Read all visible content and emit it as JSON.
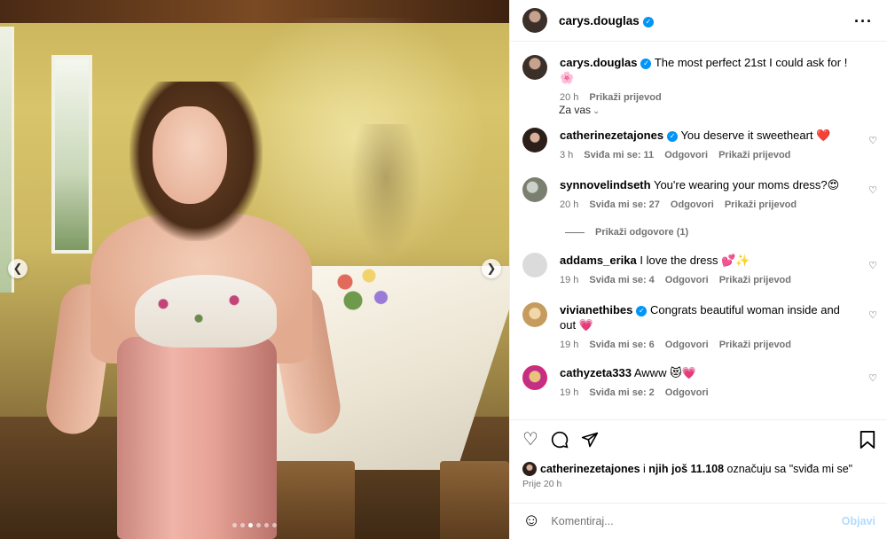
{
  "header": {
    "username": "carys.douglas",
    "more_icon": "more-horizontal-icon"
  },
  "caption": {
    "username": "carys.douglas",
    "text": "The most perfect 21st I could ask for ! 🌸",
    "time": "20 h",
    "translate": "Prikaži prijevod"
  },
  "sort_label": "Za vas",
  "comments": [
    {
      "username": "catherinezetajones",
      "verified": true,
      "text": "You deserve it sweetheart ❤️",
      "time": "3 h",
      "likes": "Sviđa mi se: 11",
      "reply": "Odgovori",
      "translate": "Prikaži prijevod"
    },
    {
      "username": "synnovelindseth",
      "verified": false,
      "text": "You're wearing your moms dress?😍",
      "time": "20 h",
      "likes": "Sviđa mi se: 27",
      "reply": "Odgovori",
      "translate": "Prikaži prijevod"
    },
    {
      "username": "addams_erika",
      "verified": false,
      "text": "I love the dress 💕✨",
      "time": "19 h",
      "likes": "Sviđa mi se: 4",
      "reply": "Odgovori",
      "translate": "Prikaži prijevod"
    },
    {
      "username": "vivianethibes",
      "verified": true,
      "text": "Congrats beautiful woman inside and out 💗",
      "time": "19 h",
      "likes": "Sviđa mi se: 6",
      "reply": "Odgovori",
      "translate": "Prikaži prijevod"
    },
    {
      "username": "cathyzeta333",
      "verified": false,
      "text": "Awww 😻💗",
      "time": "19 h",
      "likes": "Sviđa mi se: 2",
      "reply": "Odgovori"
    }
  ],
  "view_replies": "Prikaži odgovore (1)",
  "likes_line": {
    "user": "catherinezetajones",
    "mid": " i ",
    "others": "njih još 11.108",
    "suffix": " označuju sa \"sviđa mi se\""
  },
  "post_time": "Prije 20 h",
  "comment_input": {
    "placeholder": "Komentiraj...",
    "post_label": "Objavi"
  },
  "carousel": {
    "count": 6,
    "active": 3
  },
  "colors": {
    "verified": "#0095f6",
    "meta": "#737373",
    "post_disabled": "#b3dbff"
  }
}
